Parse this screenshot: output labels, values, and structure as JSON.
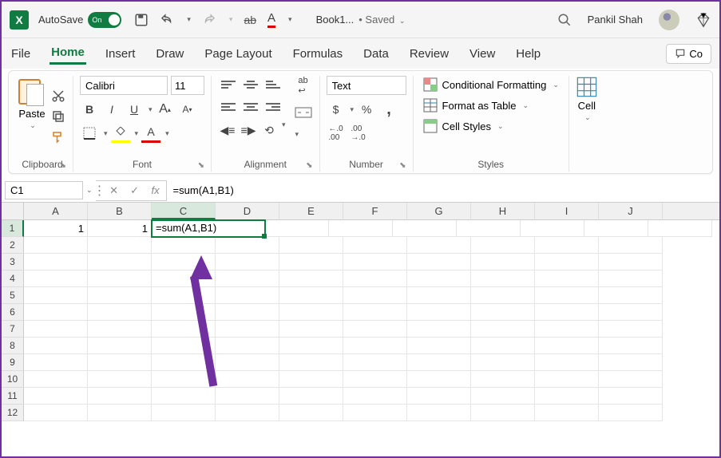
{
  "titlebar": {
    "autosave_label": "AutoSave",
    "autosave_on": "On",
    "filename": "Book1...",
    "saved_status": "• Saved",
    "user_name": "Pankil Shah"
  },
  "menu": {
    "items": [
      "File",
      "Home",
      "Insert",
      "Draw",
      "Page Layout",
      "Formulas",
      "Data",
      "Review",
      "View",
      "Help"
    ],
    "active": "Home",
    "comments": "Co"
  },
  "ribbon": {
    "clipboard": {
      "paste": "Paste",
      "label": "Clipboard"
    },
    "font": {
      "name": "Calibri",
      "size": "11",
      "bold": "B",
      "italic": "I",
      "underline": "U",
      "grow": "A",
      "shrink": "A",
      "label": "Font"
    },
    "alignment": {
      "wrap": "ab",
      "label": "Alignment"
    },
    "number": {
      "format": "Text",
      "currency": "$",
      "percent": "%",
      "comma": ",",
      "inc": ".00→.0",
      "dec": ".0→.00",
      "label": "Number"
    },
    "styles": {
      "cond": "Conditional Formatting",
      "table": "Format as Table",
      "cell": "Cell Styles",
      "label": "Styles"
    },
    "cells": {
      "label": "Cell"
    }
  },
  "formula_bar": {
    "name_box": "C1",
    "formula": "=sum(A1,B1)"
  },
  "grid": {
    "columns": [
      "A",
      "B",
      "C",
      "D",
      "E",
      "F",
      "G",
      "H",
      "I",
      "J"
    ],
    "active_col": "C",
    "active_row": 1,
    "cells": {
      "A1": "1",
      "B1": "1",
      "C1": "=sum(A1,B1)"
    },
    "visible_rows": 12
  }
}
